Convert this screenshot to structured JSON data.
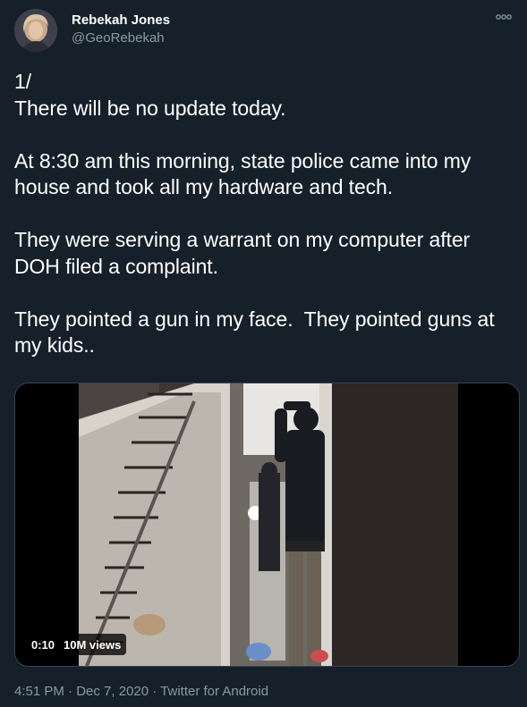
{
  "author": {
    "display_name": "Rebekah Jones",
    "handle": "@GeoRebekah"
  },
  "tweet": {
    "text": "1/\nThere will be no update today.\n\nAt 8:30 am this morning, state police came into my house and took all my hardware and tech.\n\nThey were serving a warrant on my computer after DOH filed a complaint.\n\nThey pointed a gun in my face.  They pointed guns at my kids.."
  },
  "video": {
    "duration": "0:10",
    "views": "10M views"
  },
  "meta": {
    "time": "4:51 PM",
    "separator_1": " · ",
    "date": "Dec 7, 2020",
    "separator_2": " · ",
    "source": "Twitter for Android"
  },
  "icons": {
    "more": "more-options-icon"
  },
  "colors": {
    "background": "#15202b",
    "text_primary": "#ffffff",
    "text_secondary": "#8899a6",
    "border": "#38444d"
  }
}
